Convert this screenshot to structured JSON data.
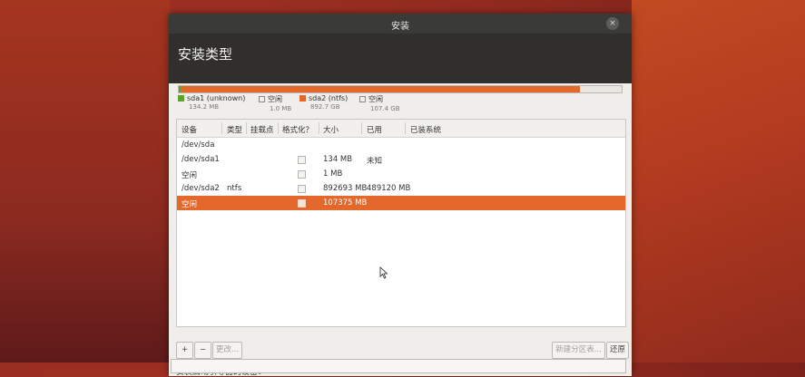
{
  "window": {
    "title": "安装",
    "close_glyph": "×",
    "page_title": "安装类型"
  },
  "disk": {
    "partitions": [
      {
        "name": "sda1 (unknown)",
        "size": "134.2 MB",
        "color": "#5ea22e",
        "fraction": 0.0001
      },
      {
        "name": "空闲",
        "size": "1.0 MB",
        "color": "#ffffff",
        "fraction": 0.0
      },
      {
        "name": "sda2 (ntfs)",
        "size": "892.7 GB",
        "color": "#e4672c",
        "fraction": 0.8926
      },
      {
        "name": "空闲",
        "size": "107.4 GB",
        "color": "#ffffff",
        "fraction": 0.1073
      }
    ]
  },
  "table": {
    "columns": [
      "设备",
      "类型",
      "挂载点",
      "格式化？",
      "大小",
      "已用",
      "已装系统"
    ],
    "rows": [
      {
        "device": "/dev/sda",
        "type": "",
        "mount": "",
        "format": false,
        "size": "",
        "used": "",
        "system": "",
        "checkbox": false
      },
      {
        "device": "/dev/sda1",
        "type": "",
        "mount": "",
        "format": false,
        "size": "134 MB",
        "used": "未知",
        "system": "",
        "checkbox": true
      },
      {
        "device": "空闲",
        "type": "",
        "mount": "",
        "format": false,
        "size": "1 MB",
        "used": "",
        "system": "",
        "checkbox": true
      },
      {
        "device": "/dev/sda2",
        "type": "ntfs",
        "mount": "",
        "format": false,
        "size": "892693 MB",
        "used": "489120 MB",
        "system": "",
        "checkbox": true
      },
      {
        "device": "空闲",
        "type": "",
        "mount": "",
        "format": false,
        "size": "107375 MB",
        "used": "",
        "system": "",
        "checkbox": true,
        "selected": true
      }
    ]
  },
  "buttons": {
    "add": "+",
    "remove": "−",
    "change": "更改...",
    "new_table": "新建分区表...",
    "revert": "还原"
  },
  "boot": {
    "label": "安装启动引导器的设备："
  },
  "colors": {
    "accent": "#e4672c",
    "sda1": "#5ea22e"
  }
}
